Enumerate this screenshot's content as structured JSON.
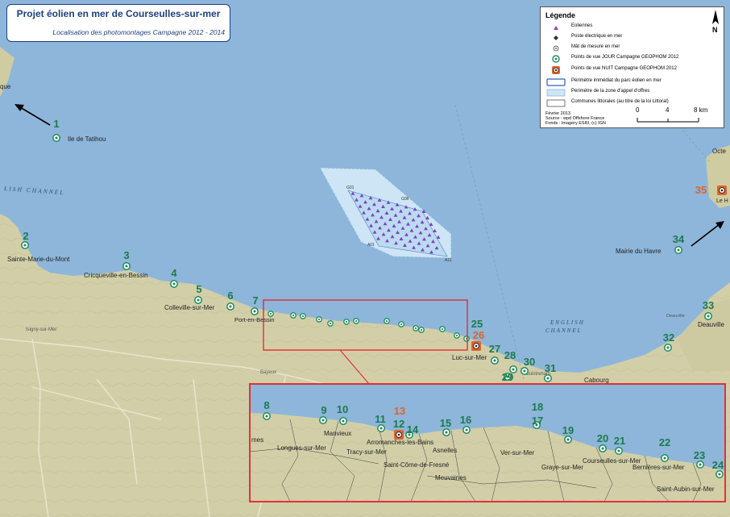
{
  "title": {
    "main": "Projet éolien en mer de Courseulles-sur-mer",
    "subtitle": "Localisation des photomontages Campagne 2012 - 2014"
  },
  "legend": {
    "title": "Légende",
    "items": [
      {
        "symbol": "turbine",
        "label": "Eoliennes"
      },
      {
        "symbol": "substation",
        "label": "Poste électrique en mer"
      },
      {
        "symbol": "mast",
        "label": "Mât de mesure en mer"
      },
      {
        "symbol": "day-point",
        "label": "Points de vue JOUR Campagne GEOPHOM 2012"
      },
      {
        "symbol": "night-point",
        "label": "Points de vue NUIT Campagne GEOPHOM 2012"
      },
      {
        "symbol": "immediate-perimeter",
        "label": "Périmètre immédiat du parc éolien en mer"
      },
      {
        "symbol": "tender-zone",
        "label": "Périmètre de la zone d'appel d'offres"
      },
      {
        "symbol": "communes",
        "label": "Communes littorales (au titre de la loi Littoral)"
      }
    ],
    "meta": [
      "Février 2013",
      "Source : wpd Offshore France",
      "Fonds : Imagery ESRI, (c) IGN"
    ],
    "scale": {
      "labels": [
        "0",
        "4",
        "8 km"
      ]
    },
    "north_label": "N"
  },
  "colors": {
    "sea": "#8db6da",
    "land": "#d2cfa8",
    "day_point": "#1d8a5a",
    "day_label": "#1d7a4e",
    "night_point": "#e0632a",
    "night_label": "#e0632a",
    "inset_frame": "#e8202a",
    "turbine": "#7b3fc4",
    "tender_zone": "#cde5f5"
  },
  "map": {
    "sea_labels": [
      {
        "text": "ENGLISH CHANNEL",
        "display": "LISH CHANNEL"
      },
      {
        "text": "ENGLISH"
      },
      {
        "text": "CHANNEL"
      }
    ],
    "farm_labels": [
      "G01",
      "G06",
      "A01",
      "A11"
    ],
    "place_labels": [
      "Ile de Tatihou",
      "Sainte-Marie-du-Mont",
      "Cricqueville-en-Bessin",
      "Colleville-sur-Mer",
      "Port-en-Bessin",
      "Luc-sur-Mer",
      "Mairie du Havre",
      "Deauville",
      "Cabourg",
      "Bayeux",
      "Isigny-sur-Mer",
      "Ouistreham",
      "Octe",
      "Le H",
      "que",
      "mes"
    ],
    "main_points": [
      {
        "n": "1",
        "kind": "day"
      },
      {
        "n": "2",
        "kind": "day"
      },
      {
        "n": "3",
        "kind": "day"
      },
      {
        "n": "4",
        "kind": "day"
      },
      {
        "n": "5",
        "kind": "day"
      },
      {
        "n": "6",
        "kind": "day"
      },
      {
        "n": "7",
        "kind": "day"
      },
      {
        "n": "25",
        "kind": "day"
      },
      {
        "n": "26",
        "kind": "night"
      },
      {
        "n": "27",
        "kind": "day"
      },
      {
        "n": "28",
        "kind": "day"
      },
      {
        "n": "29",
        "kind": "day"
      },
      {
        "n": "30",
        "kind": "day"
      },
      {
        "n": "31",
        "kind": "day"
      },
      {
        "n": "32",
        "kind": "day"
      },
      {
        "n": "33",
        "kind": "day"
      },
      {
        "n": "34",
        "kind": "day"
      },
      {
        "n": "35",
        "kind": "night"
      }
    ],
    "inset_points": [
      {
        "n": "8",
        "kind": "day"
      },
      {
        "n": "9",
        "kind": "day"
      },
      {
        "n": "10",
        "kind": "day"
      },
      {
        "n": "11",
        "kind": "day"
      },
      {
        "n": "12",
        "kind": "day"
      },
      {
        "n": "13",
        "kind": "night"
      },
      {
        "n": "14",
        "kind": "day"
      },
      {
        "n": "15",
        "kind": "day"
      },
      {
        "n": "16",
        "kind": "day"
      },
      {
        "n": "17",
        "kind": "day"
      },
      {
        "n": "18",
        "kind": "day"
      },
      {
        "n": "19",
        "kind": "day"
      },
      {
        "n": "20",
        "kind": "day"
      },
      {
        "n": "21",
        "kind": "day"
      },
      {
        "n": "22",
        "kind": "day"
      },
      {
        "n": "23",
        "kind": "day"
      },
      {
        "n": "24",
        "kind": "day"
      }
    ],
    "inset_places": [
      "Longues-sur-Mer",
      "Manvieux",
      "Tracy-sur-Mer",
      "Arromanches-les-Bains",
      "Asnelles",
      "Saint-Côme-de-Fresné",
      "Meuvaines",
      "Ver-sur-Mer",
      "Graye-sur-Mer",
      "Courseulles-sur-Mer",
      "Bernières-sur-Mer",
      "Saint-Aubin-sur-Mer"
    ]
  }
}
